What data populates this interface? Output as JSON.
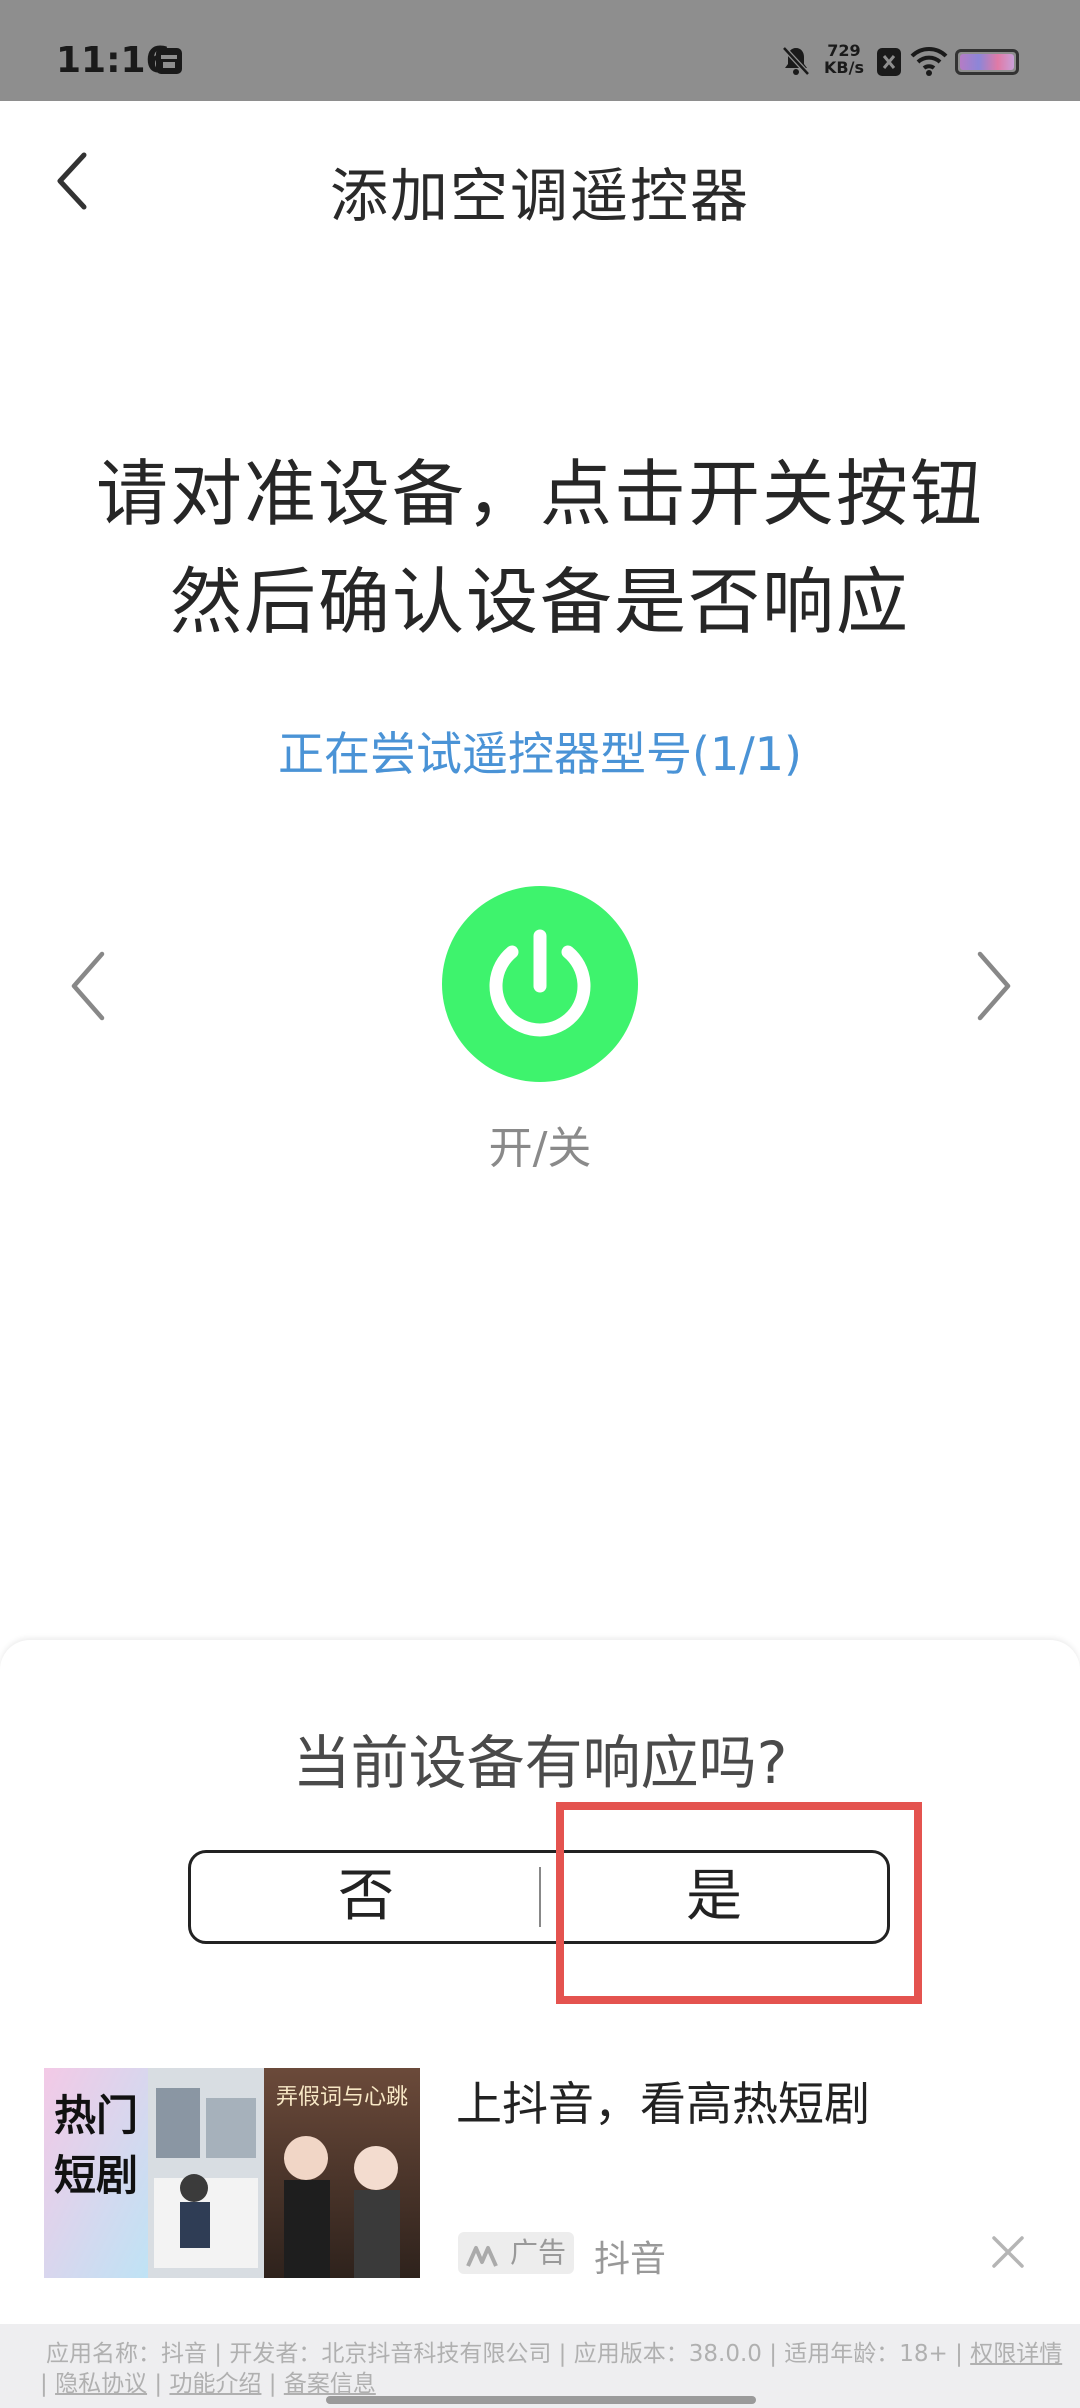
{
  "status_bar": {
    "time": "11:16",
    "net_speed_value": "729",
    "net_speed_unit": "KB/s"
  },
  "header": {
    "title": "添加空调遥控器"
  },
  "main": {
    "instruction_line1": "请对准设备，点击开关按钮",
    "instruction_line2": "然后确认设备是否响应",
    "trying_text": "正在尝试遥控器型号(1/1)",
    "power_label": "开/关"
  },
  "prompt": {
    "question": "当前设备有响应吗?",
    "no_label": "否",
    "yes_label": "是"
  },
  "ad": {
    "title": "上抖音，看高热短剧",
    "badge": "广告",
    "advertiser": "抖音",
    "image_text": "热门短剧",
    "image_text_right": "弄假词与心跳"
  },
  "footer": {
    "line1_prefix": "应用名称：抖音 | 开发者：北京抖音科技有限公司 | 应用版本：38.0.0 | 适用年龄：18+ | ",
    "permissions": "权限详情",
    "privacy": "隐私协议",
    "features": "功能介绍",
    "filing": "备案信息"
  },
  "colors": {
    "power_button": "#3ef36d",
    "trying_text": "#4a93d6",
    "highlight_box": "#e4534f",
    "status_bar": "#8e8e8e"
  },
  "icons": [
    "back-icon",
    "power-icon",
    "chevron-left-icon",
    "chevron-right-icon",
    "close-icon",
    "mute-icon",
    "wifi-icon",
    "battery-icon"
  ]
}
